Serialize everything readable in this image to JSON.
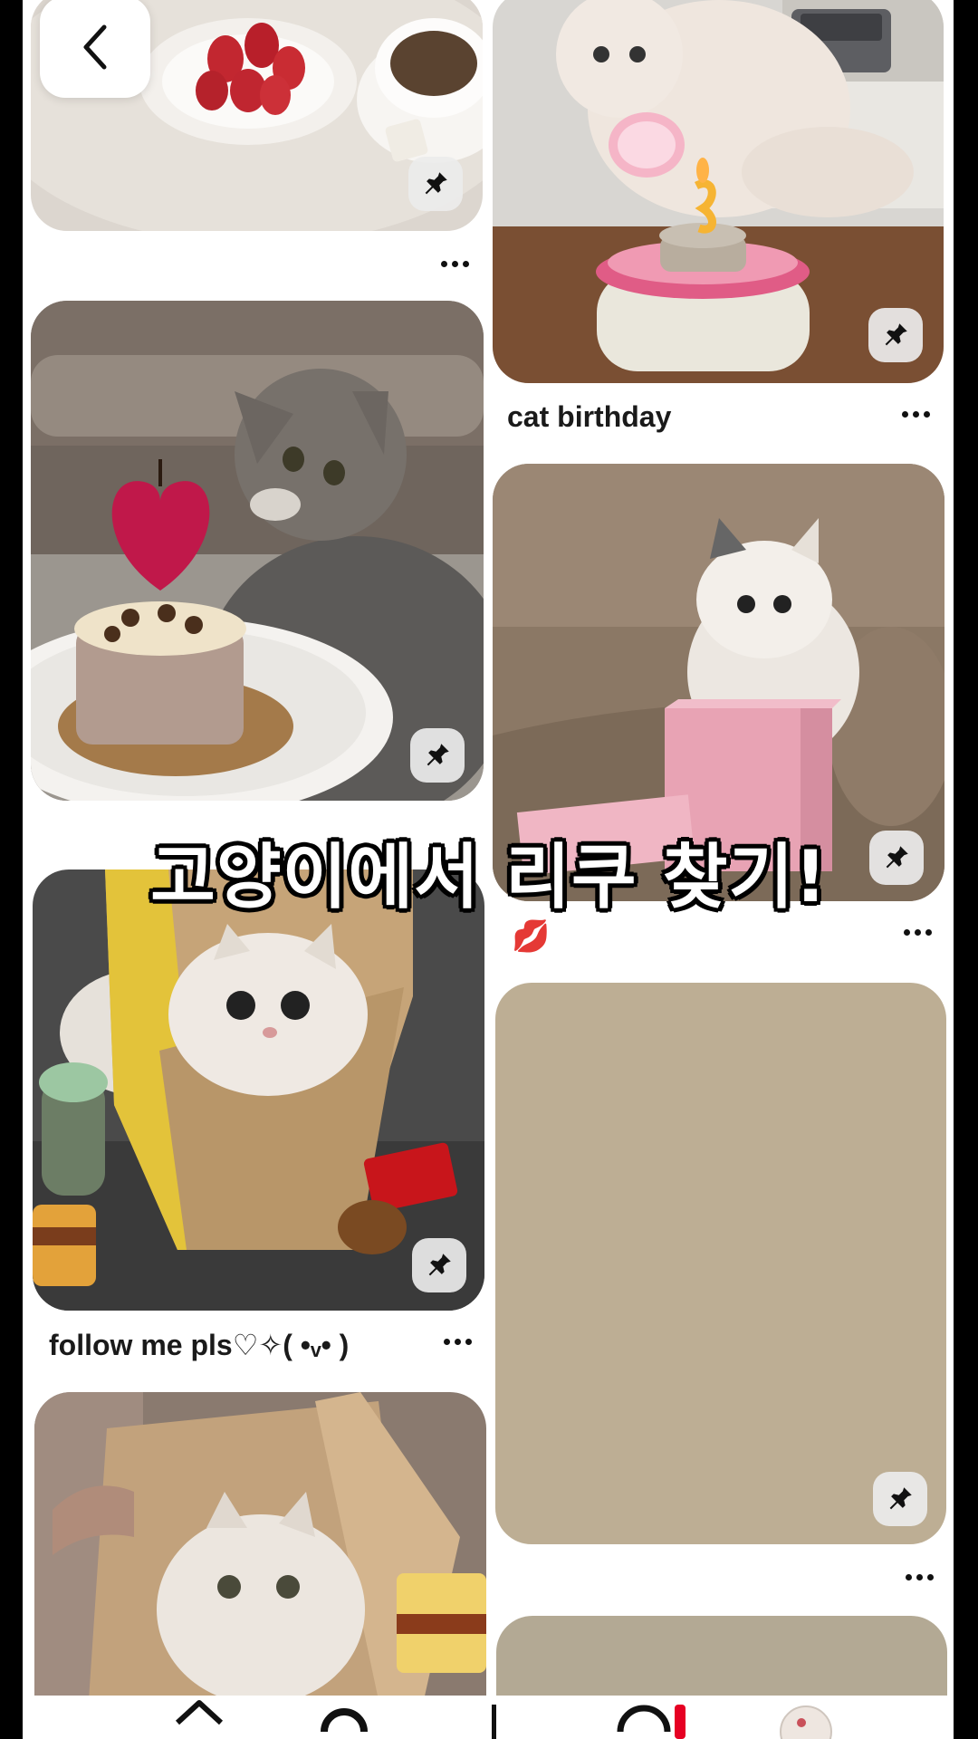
{
  "header": {
    "back_icon": "chevron-left-icon"
  },
  "overlay": {
    "caption": "고양이에서 리쿠 찾기!"
  },
  "feed": {
    "left": [
      {
        "title": "",
        "image": "strawberries-and-tea"
      },
      {
        "title": "",
        "image": "gray-cat-with-heart-cake"
      },
      {
        "title": "follow me pls♡✧( •ᵥ• )",
        "image": "fluffy-cat-in-paper-bag"
      },
      {
        "title": "",
        "image": "kitten-in-paper-bag"
      }
    ],
    "right": [
      {
        "title": "cat birthday",
        "image": "cat-with-birthday-cake"
      },
      {
        "title": "💋",
        "image": "kitten-in-pink-box"
      },
      {
        "title": "",
        "image": "loading-placeholder"
      },
      {
        "title": "",
        "image": "loading-placeholder"
      }
    ]
  },
  "icons": {
    "save": "pin-icon",
    "more": "more-dots-icon"
  },
  "colors": {
    "placeholder": "#bdae94",
    "placeholder2": "#b3a994",
    "background": "#ffffff"
  },
  "nav": [
    "home-icon",
    "search-icon",
    "create-icon",
    "notifications-icon",
    "profile-avatar"
  ]
}
